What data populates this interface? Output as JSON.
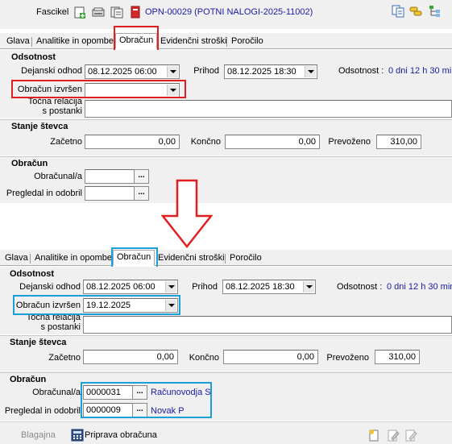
{
  "header": {
    "fascikel_label": "Fascikel",
    "fascikel_value": "OPN-00029 (POTNI NALOGI-2025-11002)"
  },
  "tabs": [
    "Glava",
    "Analitike in opombe",
    "Obračun",
    "Evidenčni stroški",
    "Poročilo"
  ],
  "before": {
    "odsotnost": {
      "title": "Odsotnost",
      "dejanski_odhod_label": "Dejanski odhod",
      "dejanski_odhod_value": "08.12.2025 06:00",
      "prihod_label": "Prihod",
      "prihod_value": "08.12.2025 18:30",
      "odsotnost_label": "Odsotnost :",
      "odsotnost_value": "0 dni 12 h 30 min",
      "obracun_izvrsen_label": "Obračun izvršen",
      "obracun_izvrsen_value": "",
      "tocna_relacija_label_1": "Točna relacija",
      "tocna_relacija_label_2": "s postanki"
    },
    "stanje": {
      "title": "Stanje števca",
      "zacetno_label": "Začetno",
      "zacetno_value": "0,00",
      "koncno_label": "Končno",
      "koncno_value": "0,00",
      "prevozeno_label": "Prevoženo",
      "prevozeno_value": "310,00"
    },
    "obracun": {
      "title": "Obračun",
      "obracunal_label": "Obračunal/a",
      "obracunal_value": "",
      "pregledal_label": "Pregledal in odobril",
      "pregledal_value": ""
    }
  },
  "after": {
    "odsotnost": {
      "title": "Odsotnost",
      "dejanski_odhod_label": "Dejanski odhod",
      "dejanski_odhod_value": "08.12.2025 06:00",
      "prihod_label": "Prihod",
      "prihod_value": "08.12.2025 18:30",
      "odsotnost_label": "Odsotnost :",
      "odsotnost_value": "0 dni 12 h 30 min",
      "obracun_izvrsen_label": "Obračun izvršen",
      "obracun_izvrsen_value": "19.12.2025",
      "tocna_relacija_label_1": "Točna relacija",
      "tocna_relacija_label_2": "s postanki"
    },
    "stanje": {
      "title": "Stanje števca",
      "zacetno_label": "Začetno",
      "zacetno_value": "0,00",
      "koncno_label": "Končno",
      "koncno_value": "0,00",
      "prevozeno_label": "Prevoženo",
      "prevozeno_value": "310,00"
    },
    "obracun": {
      "title": "Obračun",
      "obracunal_label": "Obračunal/a",
      "obracunal_value": "0000031",
      "obracunal_name": "Računovodja S",
      "pregledal_label": "Pregledal in odobril",
      "pregledal_value": "0000009",
      "pregledal_name": "Novak P"
    }
  },
  "footer": {
    "blagajna_label": "Blagajna",
    "priprava_label": "Priprava obračuna"
  },
  "lookup_glyph": "...",
  "colors": {
    "red": "#e02020",
    "blue": "#1a9fd6",
    "link": "#1a1aa6"
  }
}
